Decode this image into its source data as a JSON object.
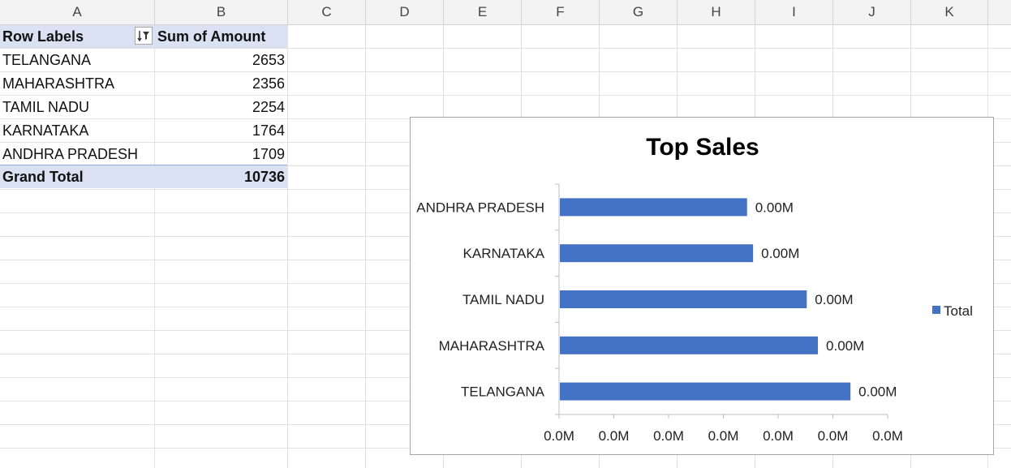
{
  "sheet": {
    "columns": [
      "A",
      "B",
      "C",
      "D",
      "E",
      "F",
      "G",
      "H",
      "I",
      "J",
      "K"
    ]
  },
  "pivot": {
    "header": {
      "row_labels": "Row Labels",
      "sum_label": "Sum of Amount"
    },
    "rows": [
      {
        "label": "TELANGANA",
        "value": "2653"
      },
      {
        "label": "MAHARASHTRA",
        "value": "2356"
      },
      {
        "label": "TAMIL NADU",
        "value": "2254"
      },
      {
        "label": "KARNATAKA",
        "value": "1764"
      },
      {
        "label": "ANDHRA PRADESH",
        "value": "1709"
      }
    ],
    "grand_total": {
      "label": "Grand Total",
      "value": "10736"
    }
  },
  "chart_data": {
    "type": "bar",
    "orientation": "horizontal",
    "title": "Top Sales",
    "categories": [
      "ANDHRA PRADESH",
      "KARNATAKA",
      "TAMIL NADU",
      "MAHARASHTRA",
      "TELANGANA"
    ],
    "series": [
      {
        "name": "Total",
        "values": [
          1709,
          1764,
          2254,
          2356,
          2653
        ],
        "color": "#4472c4"
      }
    ],
    "data_labels": [
      "0.00M",
      "0.00M",
      "0.00M",
      "0.00M",
      "0.00M"
    ],
    "x_tick_labels": [
      "0.0M",
      "0.0M",
      "0.0M",
      "0.0M",
      "0.0M",
      "0.0M",
      "0.0M"
    ],
    "xlim": [
      0,
      3000
    ],
    "legend": "right",
    "grid": false
  }
}
